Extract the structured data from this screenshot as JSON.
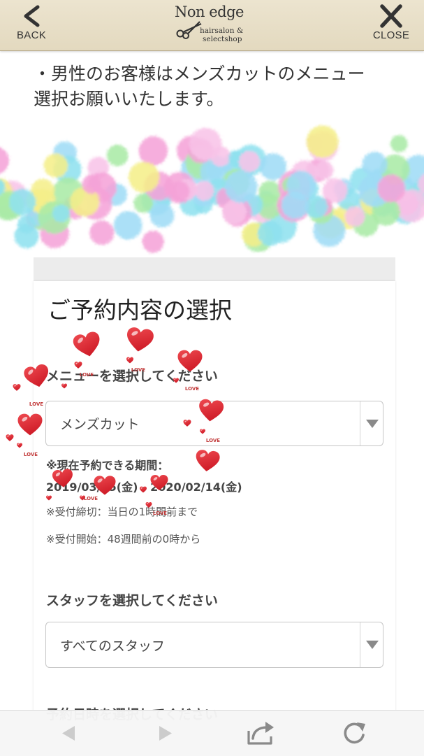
{
  "header": {
    "back_label": "BACK",
    "close_label": "CLOSE",
    "logo": {
      "name": "Non edge",
      "line1": "hairsalon &",
      "line2": "selectshop"
    }
  },
  "notice": {
    "line1": "・男性のお客様はメンズカットのメニュー",
    "line2": "選択お願いいたします。"
  },
  "booking": {
    "title": "ご予約内容の選択",
    "menu": {
      "label": "メニューを選択してください",
      "selected": "メンズカット"
    },
    "period": {
      "label": "※現在予約できる期間：",
      "range": "2019/03/15(金) - 2020/02/14(金)"
    },
    "deadline": "※受付締切：当日の1時間前まで",
    "start": "※受付開始：48週間前の0時から",
    "staff": {
      "label": "スタッフを選択してください",
      "selected": "すべてのスタッフ"
    },
    "datetime_label": "予約日時を選択してください"
  },
  "toolbar": {
    "icons": [
      "back-arrow-icon",
      "forward-arrow-icon",
      "share-icon",
      "refresh-icon"
    ]
  },
  "decoration": {
    "stamp_text": "LOVE",
    "heart_color": "#ee4a50",
    "heart_shade": "#cf1c28",
    "stamp_color": "#c23a3a",
    "blob_colors": [
      "#f5a3d8",
      "#9fdcf6",
      "#aaeba6",
      "#f5ef8a",
      "#f8c4e8",
      "#8fe1ef"
    ]
  },
  "colors": {
    "header_bg": "#e8dfc7",
    "text": "#333333",
    "disabled_icon": "#cccccc",
    "active_icon": "#8a8a8a"
  }
}
